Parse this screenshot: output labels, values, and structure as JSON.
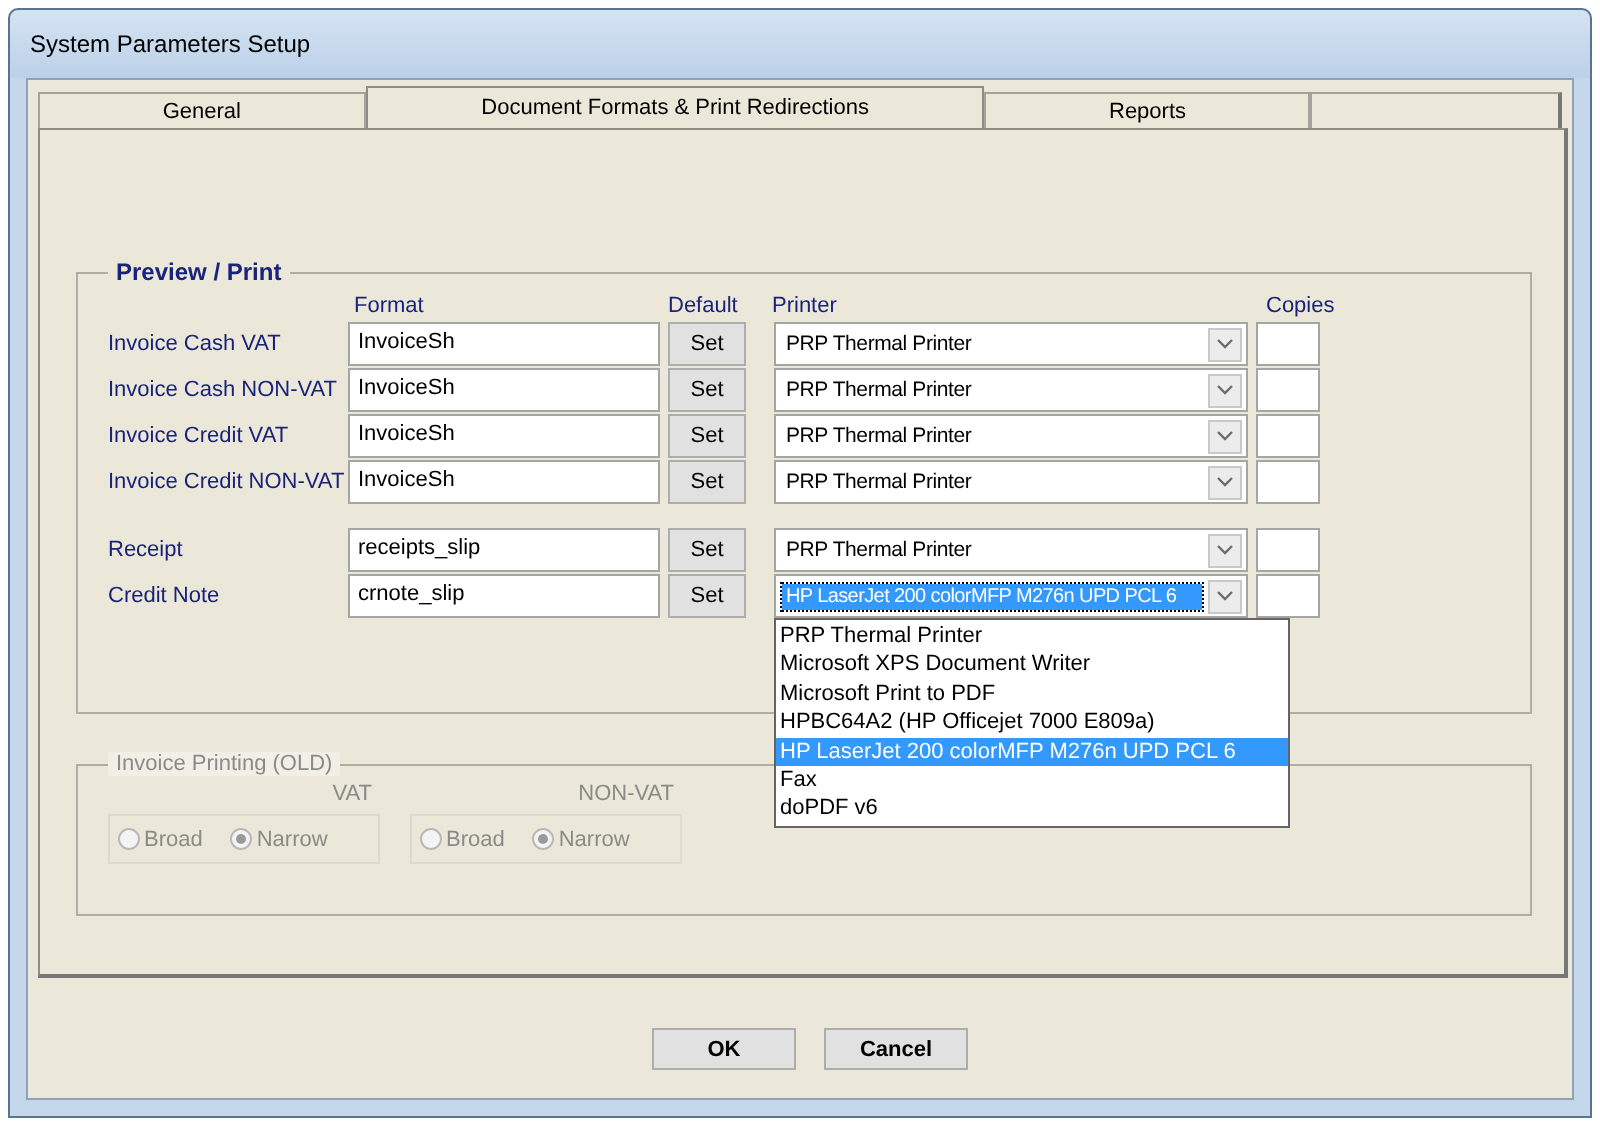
{
  "window": {
    "title": "System Parameters Setup"
  },
  "tabs": [
    {
      "label": "General",
      "selected": false
    },
    {
      "label": "Document Formats & Print Redirections",
      "selected": true
    },
    {
      "label": "Reports",
      "selected": false
    }
  ],
  "preview_print": {
    "title": "Preview / Print",
    "headers": {
      "format": "Format",
      "default": "Default",
      "printer": "Printer",
      "copies": "Copies"
    },
    "groups": [
      [
        {
          "label": "Invoice Cash VAT",
          "format": "InvoiceSh",
          "set": "Set",
          "printer": "PRP Thermal Printer",
          "expanded": false
        },
        {
          "label": "Invoice Cash NON-VAT",
          "format": "InvoiceSh",
          "set": "Set",
          "printer": "PRP Thermal Printer",
          "expanded": false
        },
        {
          "label": "Invoice Credit VAT",
          "format": "InvoiceSh",
          "set": "Set",
          "printer": "PRP Thermal Printer",
          "expanded": false
        },
        {
          "label": "Invoice Credit NON-VAT",
          "format": "InvoiceSh",
          "set": "Set",
          "printer": "PRP Thermal Printer",
          "expanded": false
        }
      ],
      [
        {
          "label": "Receipt",
          "format": "receipts_slip",
          "set": "Set",
          "printer": "PRP Thermal Printer",
          "expanded": false
        },
        {
          "label": "Credit Note",
          "format": "crnote_slip",
          "set": "Set",
          "printer": "HP LaserJet 200 colorMFP M276n UPD PCL 6",
          "expanded": true
        }
      ]
    ],
    "printer_options": [
      {
        "label": "PRP Thermal Printer",
        "selected": false
      },
      {
        "label": "Microsoft XPS Document Writer",
        "selected": false
      },
      {
        "label": "Microsoft Print to PDF",
        "selected": false
      },
      {
        "label": "HPBC64A2 (HP Officejet 7000 E809a)",
        "selected": false
      },
      {
        "label": "HP LaserJet 200 colorMFP M276n UPD PCL 6",
        "selected": true
      },
      {
        "label": "Fax",
        "selected": false
      },
      {
        "label": "doPDF v6",
        "selected": false
      }
    ]
  },
  "invoice_printing": {
    "title": "Invoice Printing (OLD)",
    "disabled": true,
    "columns": [
      {
        "label": "VAT",
        "options": [
          {
            "label": "Broad",
            "selected": false
          },
          {
            "label": "Narrow",
            "selected": true
          }
        ]
      },
      {
        "label": "NON-VAT",
        "options": [
          {
            "label": "Broad",
            "selected": false
          },
          {
            "label": "Narrow",
            "selected": true
          }
        ]
      }
    ]
  },
  "buttons": [
    {
      "label": "OK"
    },
    {
      "label": "Cancel"
    }
  ]
}
